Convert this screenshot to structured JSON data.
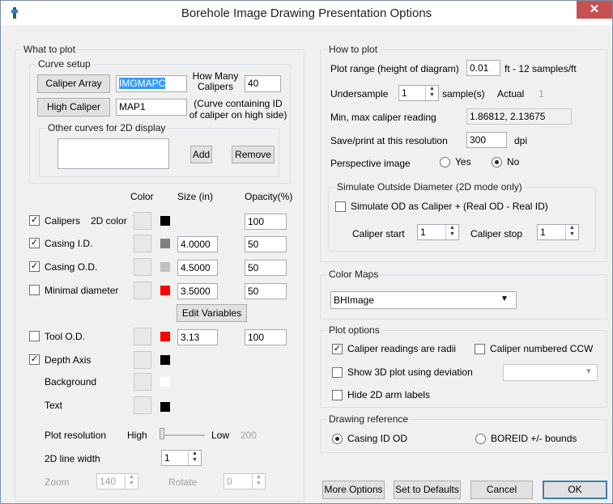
{
  "window": {
    "title": "Borehole Image Drawing Presentation Options",
    "close": "✕"
  },
  "what": {
    "legend": "What to plot",
    "curve": {
      "legend": "Curve setup",
      "caliper_array_btn": "Caliper Array",
      "caliper_array_val": "IMGMAPC",
      "how_many_label": "How Many\nCalipers",
      "how_many_val": "40",
      "high_caliper_btn": "High Caliper",
      "high_caliper_val": "MAP1",
      "curve_note": "(Curve containing ID\nof caliper on high side)",
      "other": {
        "legend": "Other curves for 2D display",
        "add": "Add",
        "remove": "Remove"
      }
    },
    "headers": {
      "color": "Color",
      "size": "Size (in)",
      "opacity": "Opacity(%)"
    },
    "rows": [
      {
        "label": "Calipers",
        "checked": true,
        "sub": "2D color",
        "chip": "#000000",
        "size": "",
        "opacity": "100"
      },
      {
        "label": "Casing I.D.",
        "checked": true,
        "sub": "",
        "chip": "#808080",
        "size": "4.0000",
        "opacity": "50"
      },
      {
        "label": "Casing O.D.",
        "checked": true,
        "sub": "",
        "chip": "#c0c0c0",
        "size": "4.5000",
        "opacity": "50"
      },
      {
        "label": "Minimal diameter",
        "checked": false,
        "sub": "",
        "chip": "#ff0000",
        "size": "3.5000",
        "opacity": "50"
      }
    ],
    "edit_vars": "Edit Variables",
    "tool": {
      "label": "Tool O.D.",
      "checked": false,
      "chip": "#ff0000",
      "size": "3.13",
      "opacity": "100"
    },
    "depth": {
      "label": "Depth Axis",
      "checked": true,
      "chip": "#000000"
    },
    "background": {
      "label": "Background",
      "chip": "#ffffff"
    },
    "text": {
      "label": "Text",
      "chip": "#000000"
    },
    "plotres": {
      "label": "Plot resolution",
      "high": "High",
      "low": "Low",
      "value": "200"
    },
    "linewidth": {
      "label": "2D line width",
      "value": "1"
    },
    "zoom": {
      "label": "Zoom",
      "value": "140"
    },
    "rotate": {
      "label": "Rotate",
      "value": "0"
    }
  },
  "how": {
    "legend": "How to plot",
    "plot_range": {
      "label": "Plot range (height of diagram)",
      "value": "0.01",
      "unit": "ft - 12 samples/ft"
    },
    "undersample": {
      "label": "Undersample",
      "value": "1",
      "unit": "sample(s)",
      "actual_label": "Actual",
      "actual_val": "1"
    },
    "minmax": {
      "label": "Min, max caliper reading",
      "value": "1.86812, 2.13675"
    },
    "res": {
      "label": "Save/print at this resolution",
      "value": "300",
      "unit": "dpi"
    },
    "persp": {
      "label": "Perspective image",
      "yes": "Yes",
      "no": "No"
    },
    "sim": {
      "legend": "Simulate Outside Diameter (2D mode only)",
      "cb": "Simulate OD as Caliper + (Real OD - Real ID)",
      "start_label": "Caliper start",
      "start_val": "1",
      "stop_label": "Caliper stop",
      "stop_val": "1"
    }
  },
  "colormaps": {
    "legend": "Color Maps",
    "value": "BHImage"
  },
  "plotopts": {
    "legend": "Plot options",
    "radii": "Caliper readings are radii",
    "ccw": "Caliper numbered CCW",
    "deviation": "Show 3D plot using deviation",
    "hide": "Hide 2D arm labels"
  },
  "drawref": {
    "legend": "Drawing reference",
    "opt1": "Casing ID OD",
    "opt2": "BOREID +/- bounds"
  },
  "footer": {
    "more": "More Options",
    "defaults": "Set to Defaults",
    "cancel": "Cancel",
    "ok": "OK"
  },
  "glyphs": {
    "check": "✓",
    "dropdown": "▼",
    "spin_up": "▲",
    "spin_down": "▼"
  }
}
